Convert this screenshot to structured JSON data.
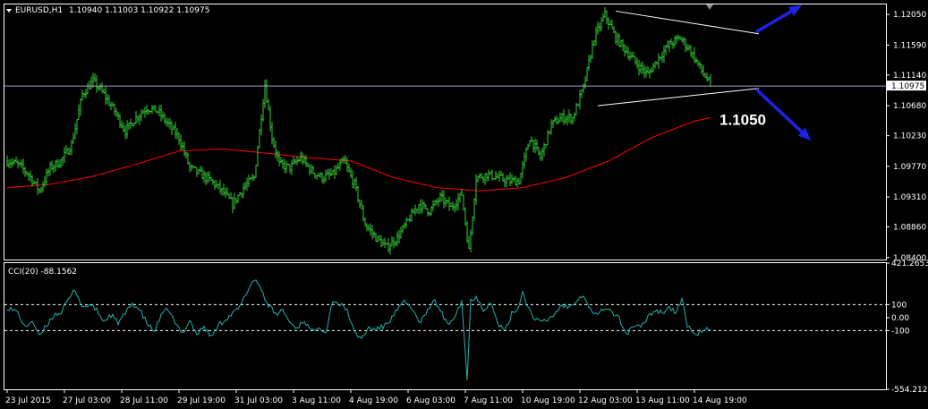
{
  "header": {
    "symbol": "EURUSD,H1",
    "ohlc": "1.10940 1.11003 1.10922 1.10975"
  },
  "indicator": {
    "label": "CCI(20) -88.1562",
    "axis_labels": [
      "421.2653",
      "100",
      "0.00",
      "-100",
      "-554.212"
    ]
  },
  "annotation": {
    "text": "1.1050"
  },
  "colors": {
    "background": "#000000",
    "frame": "#ffffff",
    "bars": "#33cc33",
    "ma": "#ff0000",
    "cci": "#20b2aa",
    "level_lines": "#ffffff",
    "price_line": "#a0a0c8",
    "current_price_bg": "#ffffff",
    "arrows": "#1e22e6",
    "trendlines": "#ffffff"
  },
  "chart_data": [
    {
      "type": "candlestick",
      "symbol": "EURUSD",
      "timeframe": "H1",
      "y_ticks": [
        1.1205,
        1.1159,
        1.1114,
        1.10975,
        1.1068,
        1.1023,
        1.0977,
        1.0931,
        1.0886,
        1.084
      ],
      "current_price": 1.10975,
      "ylim": [
        1.0837,
        1.122
      ],
      "x_ticks": [
        "23 Jul 2015",
        "27 Jul 03:00",
        "28 Jul 11:00",
        "29 Jul 19:00",
        "31 Jul 03:00",
        "3 Aug 11:00",
        "4 Aug 19:00",
        "6 Aug 03:00",
        "7 Aug 11:00",
        "10 Aug 19:00",
        "12 Aug 03:00",
        "13 Aug 11:00",
        "14 Aug 19:00"
      ],
      "x_tick_bar_index": [
        0,
        32,
        64,
        96,
        128,
        160,
        192,
        224,
        256,
        288,
        320,
        352,
        384
      ],
      "close_path": [
        [
          0,
          1.0985
        ],
        [
          6,
          1.098
        ],
        [
          12,
          1.0965
        ],
        [
          18,
          1.094
        ],
        [
          24,
          1.0975
        ],
        [
          30,
          1.0985
        ],
        [
          36,
          1.101
        ],
        [
          42,
          1.1085
        ],
        [
          48,
          1.1105
        ],
        [
          54,
          1.1085
        ],
        [
          60,
          1.106
        ],
        [
          66,
          1.103
        ],
        [
          72,
          1.105
        ],
        [
          78,
          1.1065
        ],
        [
          84,
          1.106
        ],
        [
          90,
          1.104
        ],
        [
          96,
          1.102
        ],
        [
          102,
          1.0975
        ],
        [
          108,
          1.0965
        ],
        [
          114,
          1.0955
        ],
        [
          120,
          1.094
        ],
        [
          126,
          1.092
        ],
        [
          132,
          1.0945
        ],
        [
          138,
          1.096
        ],
        [
          144,
          1.11
        ],
        [
          148,
          1.102
        ],
        [
          152,
          1.098
        ],
        [
          158,
          1.0975
        ],
        [
          164,
          1.099
        ],
        [
          170,
          1.097
        ],
        [
          176,
          1.096
        ],
        [
          182,
          1.0965
        ],
        [
          188,
          1.0985
        ],
        [
          194,
          1.095
        ],
        [
          200,
          1.089
        ],
        [
          206,
          1.087
        ],
        [
          212,
          1.0855
        ],
        [
          218,
          1.087
        ],
        [
          224,
          1.0895
        ],
        [
          230,
          1.092
        ],
        [
          236,
          1.091
        ],
        [
          242,
          1.093
        ],
        [
          248,
          1.0915
        ],
        [
          254,
          1.0935
        ],
        [
          258,
          1.085
        ],
        [
          262,
          1.096
        ],
        [
          268,
          1.0965
        ],
        [
          274,
          1.096
        ],
        [
          280,
          1.0955
        ],
        [
          286,
          1.0955
        ],
        [
          292,
          1.102
        ],
        [
          298,
          1.099
        ],
        [
          304,
          1.104
        ],
        [
          310,
          1.105
        ],
        [
          316,
          1.105
        ],
        [
          322,
          1.1095
        ],
        [
          328,
          1.117
        ],
        [
          334,
          1.1205
        ],
        [
          340,
          1.117
        ],
        [
          346,
          1.115
        ],
        [
          352,
          1.113
        ],
        [
          358,
          1.1115
        ],
        [
          364,
          1.114
        ],
        [
          370,
          1.116
        ],
        [
          376,
          1.117
        ],
        [
          382,
          1.115
        ],
        [
          388,
          1.112
        ],
        [
          393,
          1.11
        ]
      ],
      "ma_path": [
        [
          0,
          1.0945
        ],
        [
          24,
          1.095
        ],
        [
          48,
          1.0962
        ],
        [
          72,
          1.098
        ],
        [
          96,
          1.1
        ],
        [
          120,
          1.1003
        ],
        [
          144,
          1.0997
        ],
        [
          168,
          1.099
        ],
        [
          192,
          1.0985
        ],
        [
          216,
          1.096
        ],
        [
          240,
          1.0945
        ],
        [
          264,
          1.094
        ],
        [
          288,
          1.0945
        ],
        [
          312,
          1.096
        ],
        [
          336,
          1.0985
        ],
        [
          360,
          1.102
        ],
        [
          384,
          1.1045
        ],
        [
          393,
          1.105
        ]
      ],
      "trendlines": [
        {
          "from": [
            340,
            1.121
          ],
          "to": [
            420,
            1.1176
          ]
        },
        {
          "from": [
            330,
            1.1068
          ],
          "to": [
            420,
            1.1094
          ]
        }
      ],
      "annotation_price": 1.105
    },
    {
      "type": "line",
      "name": "CCI(20)",
      "last_value": -88.1562,
      "ylim": [
        -554.212,
        421.2653
      ],
      "levels": [
        100,
        0,
        -100
      ],
      "path": [
        [
          0,
          80
        ],
        [
          6,
          40
        ],
        [
          10,
          -80
        ],
        [
          14,
          -20
        ],
        [
          18,
          -150
        ],
        [
          22,
          -60
        ],
        [
          26,
          20
        ],
        [
          30,
          40
        ],
        [
          34,
          130
        ],
        [
          38,
          220
        ],
        [
          42,
          80
        ],
        [
          46,
          100
        ],
        [
          50,
          60
        ],
        [
          54,
          -30
        ],
        [
          58,
          20
        ],
        [
          62,
          -40
        ],
        [
          66,
          30
        ],
        [
          70,
          110
        ],
        [
          74,
          60
        ],
        [
          78,
          -40
        ],
        [
          82,
          -110
        ],
        [
          86,
          10
        ],
        [
          90,
          70
        ],
        [
          94,
          -50
        ],
        [
          98,
          -120
        ],
        [
          102,
          -20
        ],
        [
          106,
          -130
        ],
        [
          110,
          -70
        ],
        [
          114,
          -150
        ],
        [
          118,
          -60
        ],
        [
          122,
          -10
        ],
        [
          126,
          30
        ],
        [
          130,
          80
        ],
        [
          134,
          200
        ],
        [
          138,
          300
        ],
        [
          142,
          230
        ],
        [
          144,
          140
        ],
        [
          146,
          100
        ],
        [
          150,
          20
        ],
        [
          154,
          60
        ],
        [
          158,
          -40
        ],
        [
          162,
          -80
        ],
        [
          166,
          -20
        ],
        [
          170,
          -110
        ],
        [
          174,
          -60
        ],
        [
          178,
          -120
        ],
        [
          182,
          140
        ],
        [
          186,
          100
        ],
        [
          190,
          60
        ],
        [
          194,
          -120
        ],
        [
          198,
          -160
        ],
        [
          202,
          -80
        ],
        [
          206,
          -90
        ],
        [
          210,
          -70
        ],
        [
          214,
          -20
        ],
        [
          218,
          60
        ],
        [
          222,
          120
        ],
        [
          226,
          80
        ],
        [
          230,
          -40
        ],
        [
          234,
          20
        ],
        [
          238,
          140
        ],
        [
          242,
          60
        ],
        [
          246,
          -60
        ],
        [
          250,
          20
        ],
        [
          254,
          130
        ],
        [
          257,
          -480
        ],
        [
          259,
          130
        ],
        [
          262,
          170
        ],
        [
          266,
          60
        ],
        [
          270,
          120
        ],
        [
          274,
          -40
        ],
        [
          278,
          -110
        ],
        [
          282,
          30
        ],
        [
          286,
          90
        ],
        [
          288,
          200
        ],
        [
          291,
          80
        ],
        [
          294,
          10
        ],
        [
          298,
          -40
        ],
        [
          302,
          -20
        ],
        [
          306,
          30
        ],
        [
          310,
          100
        ],
        [
          314,
          80
        ],
        [
          318,
          140
        ],
        [
          322,
          180
        ],
        [
          326,
          60
        ],
        [
          330,
          20
        ],
        [
          334,
          80
        ],
        [
          338,
          40
        ],
        [
          342,
          -10
        ],
        [
          346,
          -130
        ],
        [
          350,
          -60
        ],
        [
          354,
          -80
        ],
        [
          358,
          10
        ],
        [
          362,
          60
        ],
        [
          366,
          40
        ],
        [
          370,
          80
        ],
        [
          374,
          30
        ],
        [
          377,
          160
        ],
        [
          380,
          -60
        ],
        [
          384,
          -140
        ],
        [
          388,
          -100
        ],
        [
          393,
          -88
        ]
      ]
    }
  ]
}
